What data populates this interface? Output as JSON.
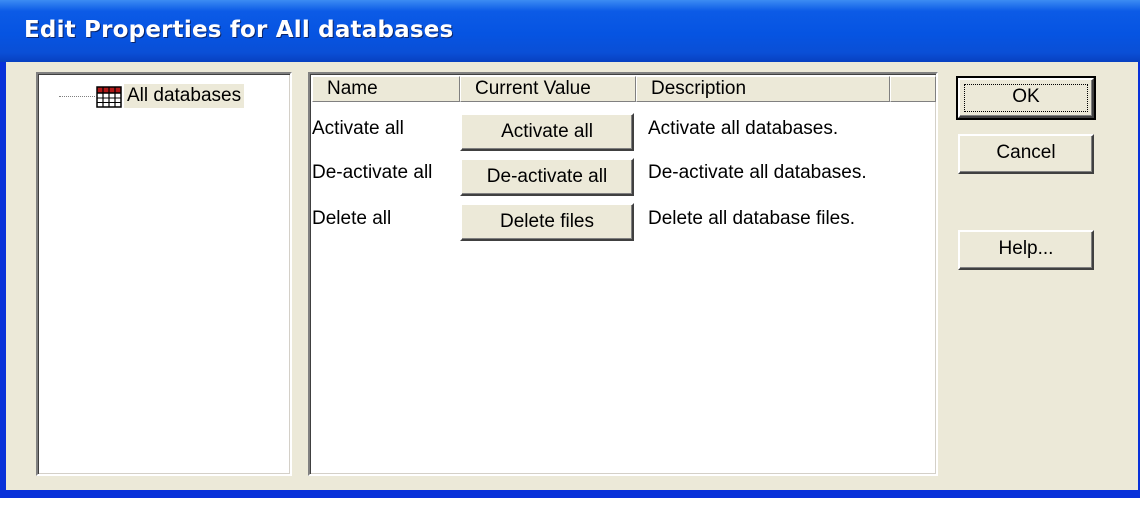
{
  "window": {
    "title": "Edit Properties for All databases"
  },
  "tree": {
    "root_label": "All databases",
    "root_icon": "database-grid-icon"
  },
  "grid": {
    "columns": [
      "Name",
      "Current Value",
      "Description"
    ],
    "rows": [
      {
        "name": "Activate all",
        "value_button": "Activate all",
        "description": "Activate all databases."
      },
      {
        "name": "De-activate all",
        "value_button": "De-activate all",
        "description": "De-activate all databases."
      },
      {
        "name": "Delete all",
        "value_button": "Delete files",
        "description": "Delete all database files."
      }
    ]
  },
  "buttons": {
    "ok": "OK",
    "cancel": "Cancel",
    "help": "Help..."
  },
  "colors": {
    "titlebar": "#0654e2",
    "dialog_bg": "#ece9d8",
    "icon_red": "#b01818"
  }
}
